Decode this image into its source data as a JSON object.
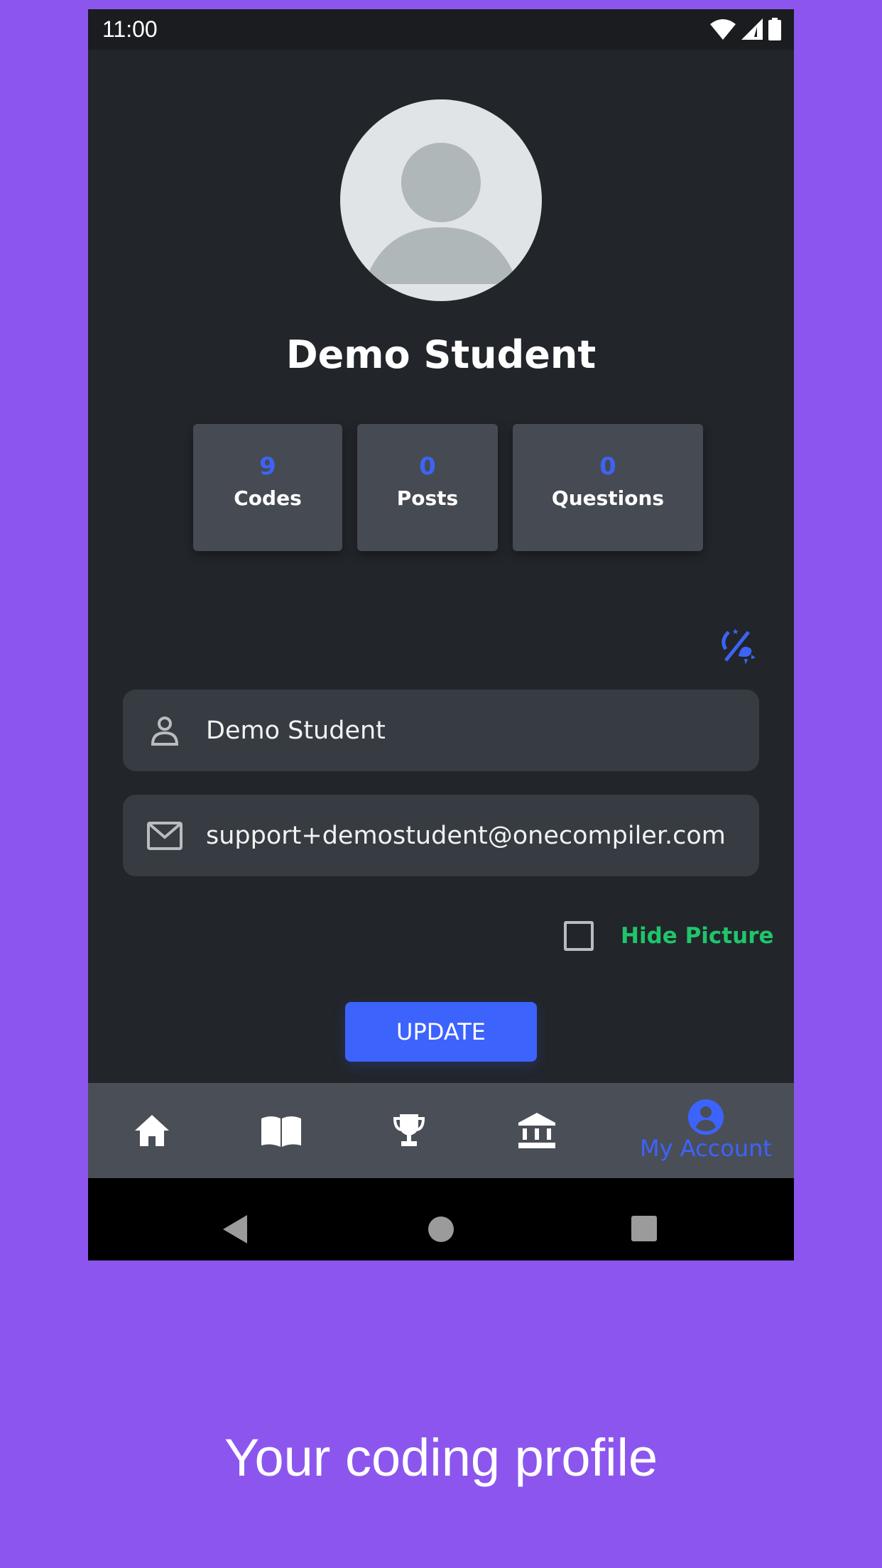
{
  "status_bar": {
    "time": "11:00"
  },
  "profile": {
    "name": "Demo Student"
  },
  "stats": [
    {
      "value": "9",
      "label": "Codes"
    },
    {
      "value": "0",
      "label": "Posts"
    },
    {
      "value": "0",
      "label": "Questions"
    }
  ],
  "form": {
    "name_value": "Demo Student",
    "email_value": "support+demostudent@onecompiler.com",
    "hide_picture_label": "Hide Picture",
    "hide_picture_checked": false,
    "update_label": "UPDATE"
  },
  "bottom_nav": {
    "items": [
      {
        "icon": "home-icon"
      },
      {
        "icon": "book-icon"
      },
      {
        "icon": "trophy-icon"
      },
      {
        "icon": "bank-icon"
      },
      {
        "icon": "account-circle-icon",
        "label": "My Account",
        "active": true
      }
    ]
  },
  "colors": {
    "accent": "#3d63fd",
    "green": "#20c46b",
    "background": "#8c56ee"
  },
  "caption": "Your coding profile"
}
